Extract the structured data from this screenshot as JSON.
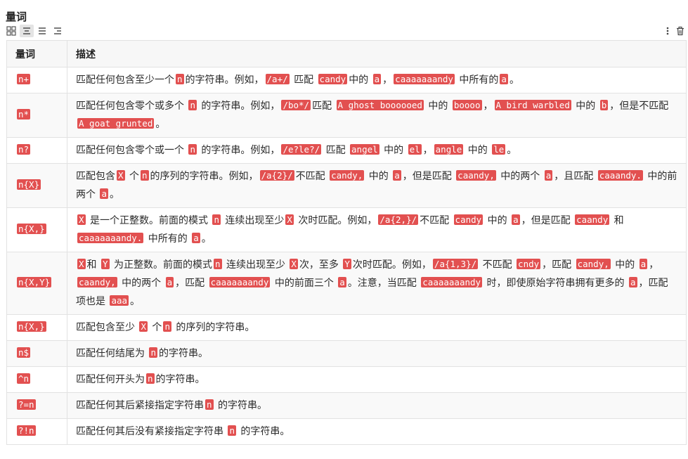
{
  "page": {
    "title": "量词"
  },
  "toolbar": {
    "left_icons": [
      "grid-icon",
      "align-center-icon",
      "align-justify-icon",
      "align-right-icon"
    ],
    "right_icons": [
      "more-vertical-icon",
      "trash-icon"
    ]
  },
  "table": {
    "headers": [
      "量词",
      "描述"
    ],
    "rows": [
      {
        "quantifier": "n+",
        "desc": [
          {
            "t": "匹配任何包含至少一个"
          },
          {
            "c": "n"
          },
          {
            "t": "的字符串。例如，"
          },
          {
            "c": "/a+/"
          },
          {
            "t": " 匹配 "
          },
          {
            "c": "candy"
          },
          {
            "t": "中的 "
          },
          {
            "c": "a"
          },
          {
            "t": "，"
          },
          {
            "c": "caaaaaaandy"
          },
          {
            "t": " 中所有的"
          },
          {
            "c": "a"
          },
          {
            "t": "。"
          }
        ]
      },
      {
        "quantifier": "n*",
        "desc": [
          {
            "t": "匹配任何包含零个或多个 "
          },
          {
            "c": "n"
          },
          {
            "t": " 的字符串。例如，"
          },
          {
            "c": "/bo*/"
          },
          {
            "t": "匹配 "
          },
          {
            "c": "A ghost boooooed"
          },
          {
            "t": " 中的 "
          },
          {
            "c": "boooo"
          },
          {
            "t": "，"
          },
          {
            "c": "A bird warbled"
          },
          {
            "t": " 中的 "
          },
          {
            "c": "b"
          },
          {
            "t": "，但是不匹配 "
          },
          {
            "c": "A goat grunted"
          },
          {
            "t": "。"
          }
        ]
      },
      {
        "quantifier": "n?",
        "desc": [
          {
            "t": "匹配任何包含零个或一个 "
          },
          {
            "c": "n"
          },
          {
            "t": " 的字符串。例如，"
          },
          {
            "c": "/e?le?/"
          },
          {
            "t": " 匹配 "
          },
          {
            "c": "angel"
          },
          {
            "t": " 中的 "
          },
          {
            "c": "el"
          },
          {
            "t": "，"
          },
          {
            "c": "angle"
          },
          {
            "t": " 中的 "
          },
          {
            "c": "le"
          },
          {
            "t": "。"
          }
        ]
      },
      {
        "quantifier": "n{X}",
        "desc": [
          {
            "t": "匹配包含"
          },
          {
            "c": "X"
          },
          {
            "t": " 个"
          },
          {
            "c": "n"
          },
          {
            "t": "的序列的字符串。例如，"
          },
          {
            "c": "/a{2}/"
          },
          {
            "t": "不匹配 "
          },
          {
            "c": "candy,"
          },
          {
            "t": " 中的 "
          },
          {
            "c": "a"
          },
          {
            "t": "，但是匹配 "
          },
          {
            "c": "caandy,"
          },
          {
            "t": " 中的两个 "
          },
          {
            "c": "a"
          },
          {
            "t": "，且匹配 "
          },
          {
            "c": "caaandy."
          },
          {
            "t": " 中的前两个 "
          },
          {
            "c": "a"
          },
          {
            "t": "。"
          }
        ]
      },
      {
        "quantifier": "n{X,}",
        "desc": [
          {
            "c": "X"
          },
          {
            "t": " 是一个正整数。前面的模式 "
          },
          {
            "c": "n"
          },
          {
            "t": " 连续出现至少"
          },
          {
            "c": "X"
          },
          {
            "t": " 次时匹配。例如，"
          },
          {
            "c": "/a{2,}/"
          },
          {
            "t": "不匹配 "
          },
          {
            "c": "candy"
          },
          {
            "t": " 中的 "
          },
          {
            "c": "a"
          },
          {
            "t": "，但是匹配 "
          },
          {
            "c": "caandy"
          },
          {
            "t": " 和 "
          },
          {
            "c": "caaaaaaandy."
          },
          {
            "t": " 中所有的 "
          },
          {
            "c": "a"
          },
          {
            "t": "。"
          }
        ]
      },
      {
        "quantifier": "n{X,Y}",
        "desc": [
          {
            "c": "X"
          },
          {
            "t": "和 "
          },
          {
            "c": "Y"
          },
          {
            "t": " 为正整数。前面的模式"
          },
          {
            "c": "n"
          },
          {
            "t": " 连续出现至少 "
          },
          {
            "c": "X"
          },
          {
            "t": "次，至多 "
          },
          {
            "c": "Y"
          },
          {
            "t": "次时匹配。例如，"
          },
          {
            "c": "/a{1,3}/"
          },
          {
            "t": " 不匹配 "
          },
          {
            "c": "cndy"
          },
          {
            "t": "，匹配 "
          },
          {
            "c": "candy,"
          },
          {
            "t": " 中的 "
          },
          {
            "c": "a"
          },
          {
            "t": "，"
          },
          {
            "c": "caandy,"
          },
          {
            "t": " 中的两个 "
          },
          {
            "c": "a"
          },
          {
            "t": "，匹配 "
          },
          {
            "c": "caaaaaaandy"
          },
          {
            "t": " 中的前面三个 "
          },
          {
            "c": "a"
          },
          {
            "t": "。注意，当匹配 "
          },
          {
            "c": "caaaaaaandy"
          },
          {
            "t": " 时，即使原始字符串拥有更多的 "
          },
          {
            "c": "a"
          },
          {
            "t": "，匹配项也是 "
          },
          {
            "c": "aaa"
          },
          {
            "t": "。"
          }
        ]
      },
      {
        "quantifier": "n{X,}",
        "desc": [
          {
            "t": "匹配包含至少 "
          },
          {
            "c": "X"
          },
          {
            "t": " 个"
          },
          {
            "c": "n"
          },
          {
            "t": " 的序列的字符串。"
          }
        ]
      },
      {
        "quantifier": "n$",
        "desc": [
          {
            "t": "匹配任何结尾为 "
          },
          {
            "c": "n"
          },
          {
            "t": "的字符串。"
          }
        ]
      },
      {
        "quantifier": "^n",
        "desc": [
          {
            "t": "匹配任何开头为"
          },
          {
            "c": "n"
          },
          {
            "t": "的字符串。"
          }
        ]
      },
      {
        "quantifier": "?=n",
        "desc": [
          {
            "t": "匹配任何其后紧接指定字符串"
          },
          {
            "c": "n"
          },
          {
            "t": " 的字符串。"
          }
        ]
      },
      {
        "quantifier": "?!n",
        "desc": [
          {
            "t": "匹配任何其后没有紧接指定字符串 "
          },
          {
            "c": "n"
          },
          {
            "t": " 的字符串。"
          }
        ]
      }
    ]
  }
}
